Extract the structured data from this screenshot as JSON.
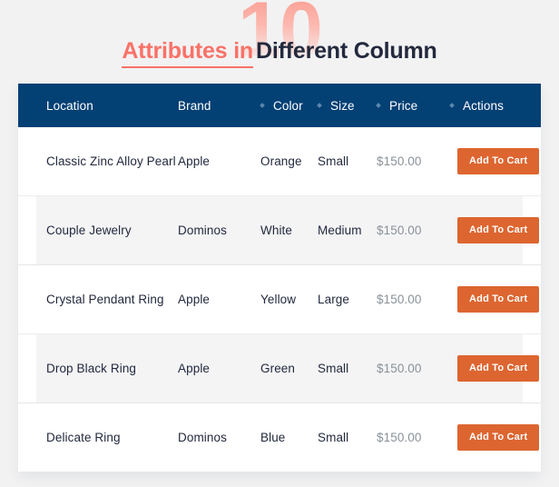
{
  "heading": {
    "watermark": "10",
    "accent_text": "Attributes in",
    "rest_text": "Different Column"
  },
  "table": {
    "columns": [
      {
        "label": "Location",
        "has_dot": false
      },
      {
        "label": "Brand",
        "has_dot": false
      },
      {
        "label": "Color",
        "has_dot": true
      },
      {
        "label": "Size",
        "has_dot": true
      },
      {
        "label": "Price",
        "has_dot": true
      },
      {
        "label": "Actions",
        "has_dot": true
      }
    ],
    "rows": [
      {
        "location": "Classic Zinc Alloy Pearl",
        "brand": "Apple",
        "color": "Orange",
        "size": "Small",
        "price": "$150.00",
        "action_label": "Add To Cart"
      },
      {
        "location": "Couple Jewelry",
        "brand": "Dominos",
        "color": "White",
        "size": "Medium",
        "price": "$150.00",
        "action_label": "Add To Cart"
      },
      {
        "location": "Crystal Pendant Ring",
        "brand": "Apple",
        "color": "Yellow",
        "size": "Large",
        "price": "$150.00",
        "action_label": "Add To Cart"
      },
      {
        "location": "Drop Black Ring",
        "brand": "Apple",
        "color": "Green",
        "size": "Small",
        "price": "$150.00",
        "action_label": "Add To Cart"
      },
      {
        "location": "Delicate Ring",
        "brand": "Dominos",
        "color": "Blue",
        "size": "Small",
        "price": "$150.00",
        "action_label": "Add To Cart"
      }
    ]
  },
  "colors": {
    "page_background": "#f2f2f3",
    "header_navy": "#034074",
    "accent_coral": "#fa7268",
    "button_orange": "#dd6530",
    "text_dark": "#23293d",
    "price_gray": "#8a9199",
    "stripe_gray": "#f4f4f5"
  }
}
